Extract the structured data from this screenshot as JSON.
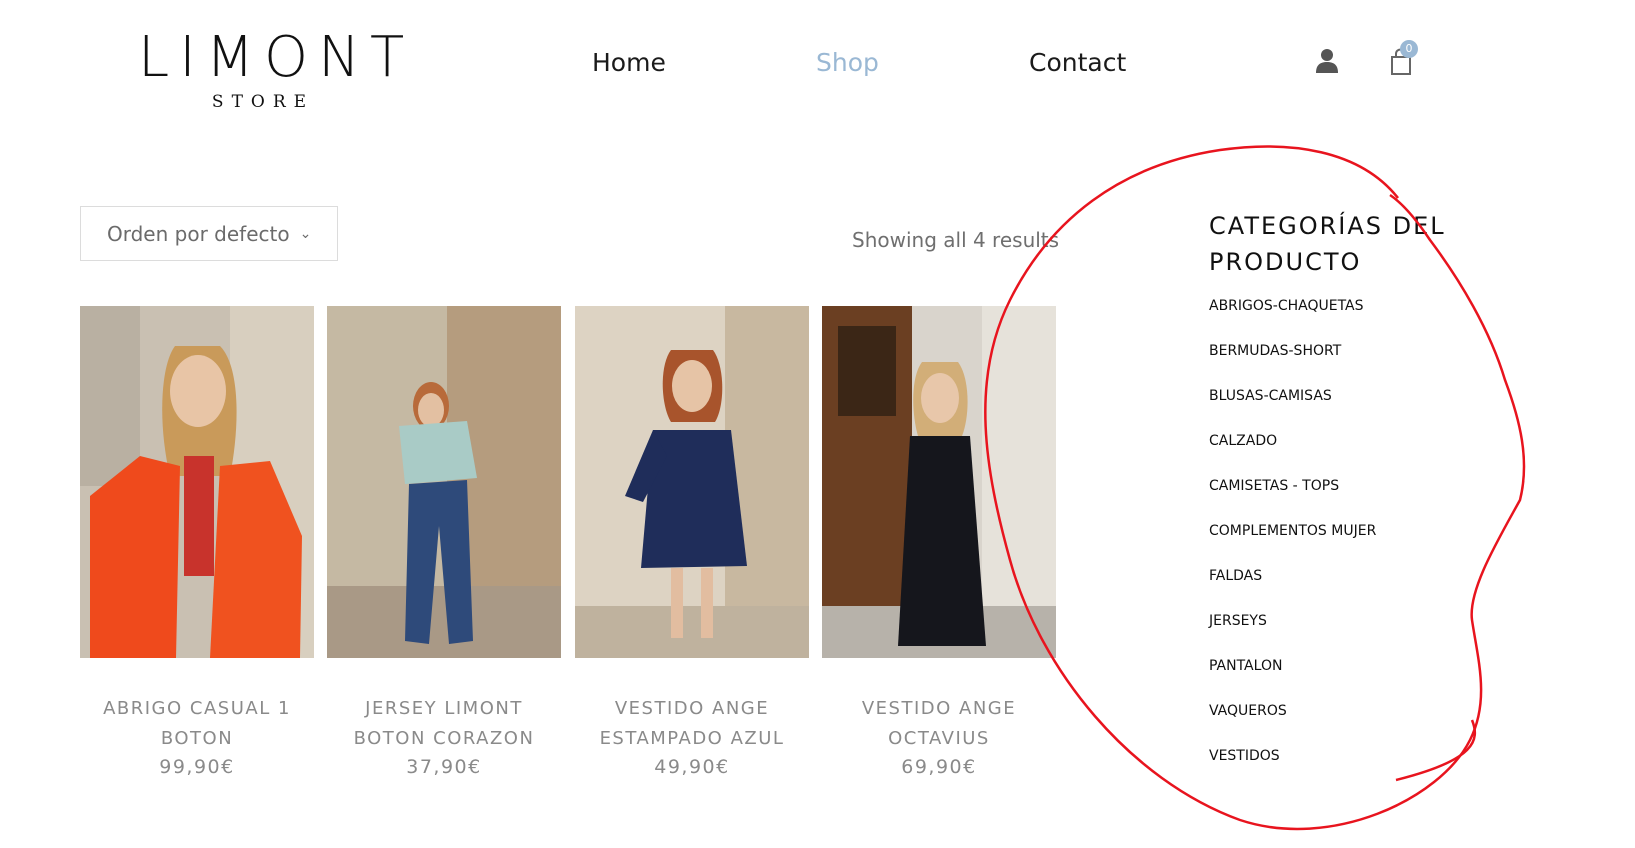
{
  "logo": {
    "main": "LIMONT",
    "sub": "STORE"
  },
  "nav": {
    "home": "Home",
    "shop": "Shop",
    "contact": "Contact"
  },
  "header_icons": {
    "user": "user-icon",
    "cart": "cart-icon",
    "cart_count": "0"
  },
  "toolbar": {
    "sort_label": "Orden por defecto",
    "result_count": "Showing all 4 results"
  },
  "products": [
    {
      "title": "ABRIGO CASUAL 1 BOTON",
      "price": "99,90€"
    },
    {
      "title": "JERSEY LIMONT BOTON CORAZON",
      "price": "37,90€"
    },
    {
      "title": "VESTIDO ANGE ESTAMPADO AZUL",
      "price": "49,90€"
    },
    {
      "title": "VESTIDO ANGE OCTAVIUS",
      "price": "69,90€"
    }
  ],
  "sidebar": {
    "title": "CATEGORÍAS DEL PRODUCTO",
    "categories": [
      "ABRIGOS-CHAQUETAS",
      "BERMUDAS-SHORT",
      "BLUSAS-CAMISAS",
      "CALZADO",
      "CAMISETAS - TOPS",
      "COMPLEMENTOS MUJER",
      "FALDAS",
      "JERSEYS",
      "PANTALON",
      "VAQUEROS",
      "VESTIDOS"
    ]
  },
  "colors": {
    "accent": "#9ab8d4",
    "annotation": "#e8141e",
    "muted_text": "#8a8a8a"
  }
}
